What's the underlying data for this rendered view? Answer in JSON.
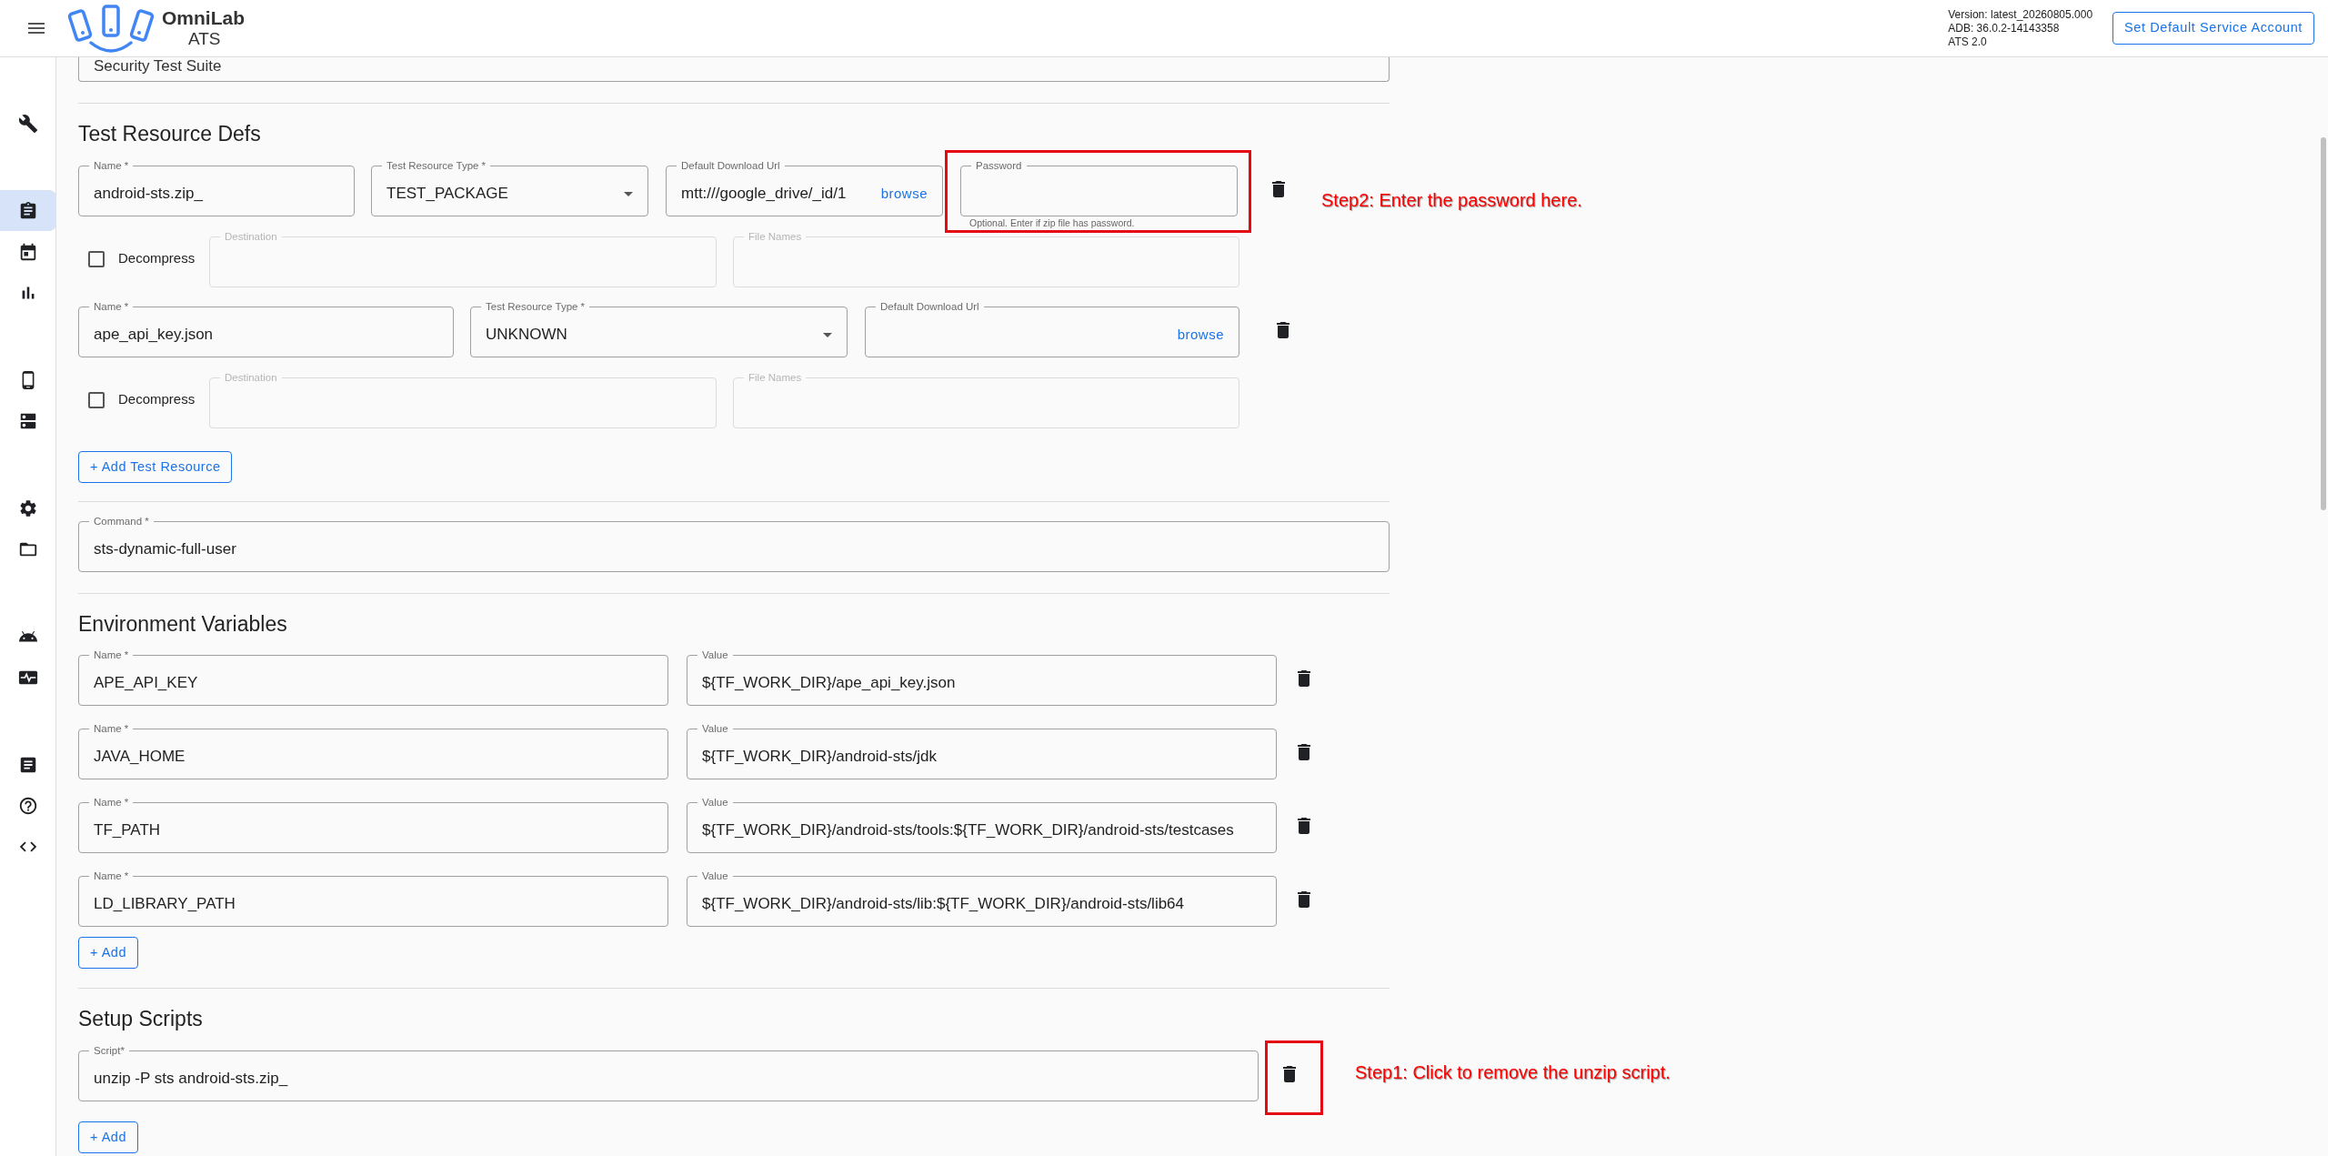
{
  "header": {
    "logo_title": "OmniLab",
    "logo_subtitle": "ATS",
    "info_lines": [
      "Version: latest_20260805.000",
      "ADB: 36.0.2-14143358",
      "ATS 2.0"
    ],
    "account_button": "Set Default Service Account"
  },
  "sidebar": {
    "groups": [
      [
        {
          "selected": false
        }
      ],
      [
        {
          "selected": true
        },
        {
          "selected": false
        },
        {
          "selected": false
        }
      ],
      [
        {
          "selected": false
        },
        {
          "selected": false
        }
      ],
      [
        {
          "selected": false
        },
        {
          "selected": false
        }
      ],
      [
        {
          "selected": false
        },
        {
          "selected": false
        }
      ],
      [
        {
          "selected": false
        },
        {
          "selected": false
        },
        {
          "selected": false
        }
      ]
    ]
  },
  "suite_field": {
    "value": "Security Test Suite"
  },
  "test_resource_defs": {
    "title": "Test Resource Defs",
    "resources": [
      {
        "name": {
          "label": "Name *",
          "value": "android-sts.zip_"
        },
        "type": {
          "label": "Test Resource Type *",
          "value": "TEST_PACKAGE"
        },
        "url": {
          "label": "Default Download Url",
          "value": "mtt:///google_drive/_id/1",
          "link": "browse"
        },
        "password": {
          "label": "Password",
          "hint": "Optional. Enter if zip file has password.",
          "annotation": "Step2: Enter the password here."
        },
        "decompress": {
          "label": "Decompress",
          "checked": false
        },
        "destination": {
          "label": "Destination",
          "disabled": true
        },
        "file_names": {
          "label": "File Names",
          "disabled": true
        }
      },
      {
        "name": {
          "label": "Name *",
          "value": "ape_api_key.json"
        },
        "type": {
          "label": "Test Resource Type *",
          "value": "UNKNOWN"
        },
        "url": {
          "label": "Default Download Url",
          "link": "browse"
        },
        "decompress": {
          "label": "Decompress",
          "checked": false
        },
        "destination": {
          "label": "Destination",
          "disabled": true
        },
        "file_names": {
          "label": "File Names",
          "disabled": true
        }
      }
    ],
    "add_button": "+ Add Test Resource"
  },
  "command": {
    "label": "Command *",
    "value": "sts-dynamic-full-user"
  },
  "environment_variables": {
    "title": "Environment Variables",
    "rows": [
      {
        "name_label": "Name *",
        "name": "APE_API_KEY",
        "value_label": "Value",
        "value": "${TF_WORK_DIR}/ape_api_key.json"
      },
      {
        "name_label": "Name *",
        "name": "JAVA_HOME",
        "value_label": "Value",
        "value": "${TF_WORK_DIR}/android-sts/jdk"
      },
      {
        "name_label": "Name *",
        "name": "TF_PATH",
        "value_label": "Value",
        "value": "${TF_WORK_DIR}/android-sts/tools:${TF_WORK_DIR}/android-sts/testcases"
      },
      {
        "name_label": "Name *",
        "name": "LD_LIBRARY_PATH",
        "value_label": "Value",
        "value": "${TF_WORK_DIR}/android-sts/lib:${TF_WORK_DIR}/android-sts/lib64"
      }
    ],
    "add_button": "+ Add"
  },
  "setup_scripts": {
    "title": "Setup Scripts",
    "scripts": [
      {
        "label": "Script*",
        "value": "unzip -P sts android-sts.zip_",
        "annotation": "Step1: Click to remove the unzip script."
      }
    ],
    "add_button": "+ Add"
  }
}
